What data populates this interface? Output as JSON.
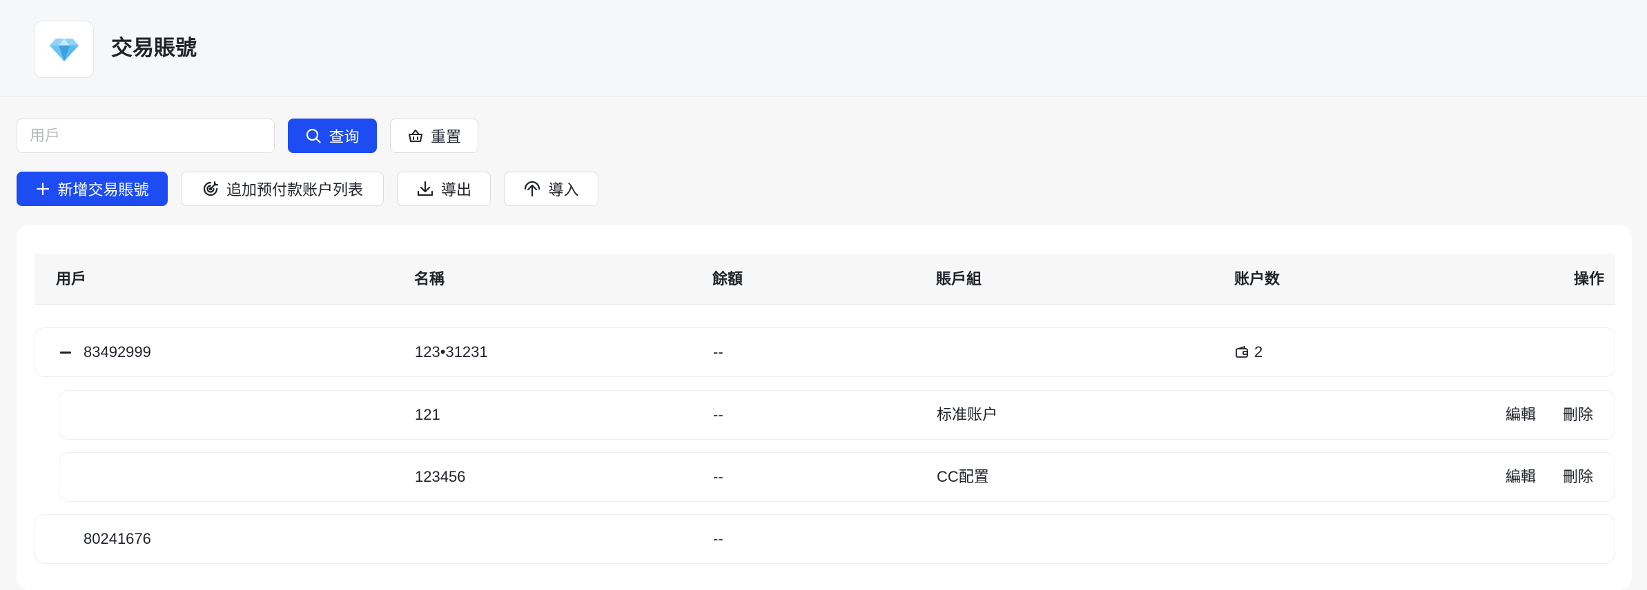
{
  "header": {
    "logo_icon": "diamond-icon",
    "title": "交易賬號"
  },
  "filter": {
    "user_placeholder": "用戶",
    "user_value": "",
    "search_label": "查询",
    "reset_label": "重置"
  },
  "toolbar": {
    "add_label": "新增交易賬號",
    "append_label": "追加预付款账户列表",
    "export_label": "導出",
    "import_label": "導入"
  },
  "table": {
    "columns": [
      "用戶",
      "名稱",
      "餘額",
      "賬戶組",
      "账户数",
      "操作"
    ],
    "rows": [
      {
        "user": "83492999",
        "name": "123•31231",
        "balance": "--",
        "group": "",
        "count": "2",
        "expanded": true
      },
      {
        "user": "",
        "name": "121",
        "balance": "--",
        "group": "标准账户",
        "edit": "編輯",
        "delete": "刪除"
      },
      {
        "user": "",
        "name": "123456",
        "balance": "--",
        "group": "CC配置",
        "edit": "編輯",
        "delete": "刪除"
      },
      {
        "user": "80241676",
        "name": "",
        "balance": "--",
        "group": ""
      }
    ]
  },
  "colors": {
    "primary": "#1c4cf2",
    "background": "#f7f7f8"
  }
}
